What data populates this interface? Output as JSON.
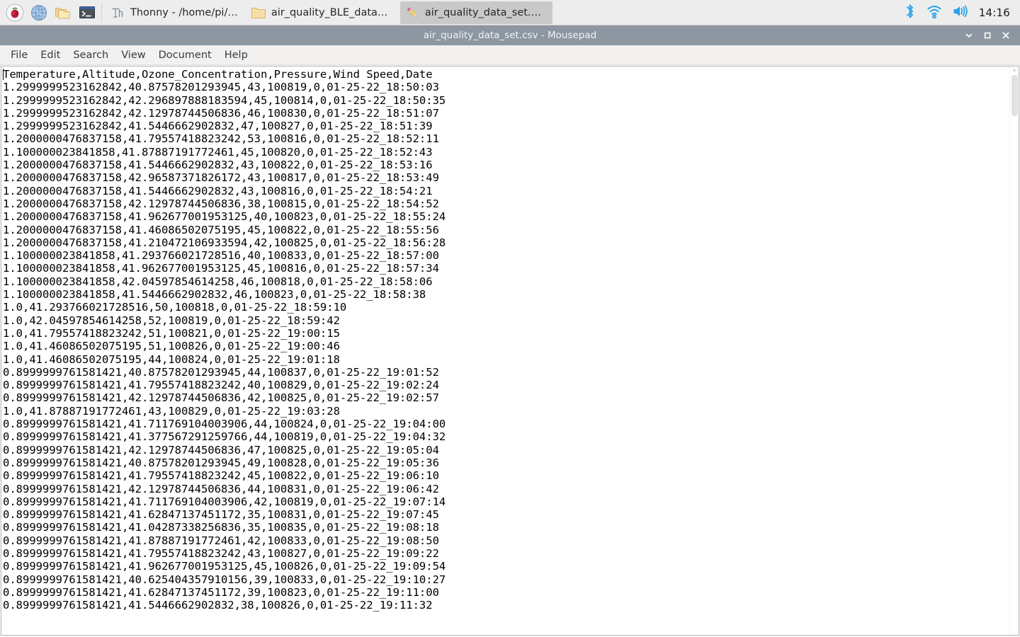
{
  "taskbar": {
    "launchers": [
      {
        "name": "raspberry-pi-menu-icon",
        "label": "Raspberry Pi Menu"
      },
      {
        "name": "web-browser-icon",
        "label": "Web Browser"
      },
      {
        "name": "file-manager-icon",
        "label": "File Manager"
      },
      {
        "name": "terminal-icon",
        "label": "Terminal"
      }
    ],
    "windows": [
      {
        "name": "taskbar-window-thonny",
        "icon": "thonny-icon",
        "label": "Thonny  -  /home/pi/…",
        "active": false
      },
      {
        "name": "taskbar-window-folder",
        "icon": "folder-icon",
        "label": "air_quality_BLE_data_…",
        "active": false
      },
      {
        "name": "taskbar-window-mousepad",
        "icon": "mousepad-pencil-icon",
        "label": "air_quality_data_set.c…",
        "active": true
      }
    ],
    "tray": [
      {
        "name": "bluetooth-icon",
        "label": "Bluetooth"
      },
      {
        "name": "wifi-icon",
        "label": "Wireless Network"
      },
      {
        "name": "volume-icon",
        "label": "Volume"
      }
    ],
    "clock": "14:16",
    "accent_color": "#29a3e8"
  },
  "window": {
    "title": "air_quality_data_set.csv - Mousepad",
    "titlebar_color": "#8c97a1",
    "controls": [
      {
        "name": "minimize-button",
        "glyph": "chevron-down-icon"
      },
      {
        "name": "maximize-button",
        "glyph": "square-icon"
      },
      {
        "name": "close-button",
        "glyph": "close-x-icon"
      }
    ]
  },
  "menubar": {
    "items": [
      {
        "name": "menu-file",
        "label": "File"
      },
      {
        "name": "menu-edit",
        "label": "Edit"
      },
      {
        "name": "menu-search",
        "label": "Search"
      },
      {
        "name": "menu-view",
        "label": "View"
      },
      {
        "name": "menu-document",
        "label": "Document"
      },
      {
        "name": "menu-help",
        "label": "Help"
      }
    ]
  },
  "editor": {
    "header_line": "Temperature,Altitude,Ozone_Concentration,Pressure,Wind Speed,Date",
    "columns": [
      "Temperature",
      "Altitude",
      "Ozone_Concentration",
      "Pressure",
      "Wind Speed",
      "Date"
    ],
    "text": "Temperature,Altitude,Ozone_Concentration,Pressure,Wind Speed,Date\n1.2999999523162842,40.87578201293945,43,100819,0,01-25-22_18:50:03\n1.2999999523162842,42.296897888183594,45,100814,0,01-25-22_18:50:35\n1.2999999523162842,42.12978744506836,46,100830,0,01-25-22_18:51:07\n1.2999999523162842,41.5446662902832,47,100827,0,01-25-22_18:51:39\n1.2000000476837158,41.79557418823242,53,100816,0,01-25-22_18:52:11\n1.100000023841858,41.87887191772461,45,100820,0,01-25-22_18:52:43\n1.2000000476837158,41.5446662902832,43,100822,0,01-25-22_18:53:16\n1.2000000476837158,42.96587371826172,43,100817,0,01-25-22_18:53:49\n1.2000000476837158,41.5446662902832,43,100816,0,01-25-22_18:54:21\n1.2000000476837158,42.12978744506836,38,100815,0,01-25-22_18:54:52\n1.2000000476837158,41.962677001953125,40,100823,0,01-25-22_18:55:24\n1.2000000476837158,41.46086502075195,45,100822,0,01-25-22_18:55:56\n1.2000000476837158,41.210472106933594,42,100825,0,01-25-22_18:56:28\n1.100000023841858,41.293766021728516,40,100833,0,01-25-22_18:57:00\n1.100000023841858,41.962677001953125,45,100816,0,01-25-22_18:57:34\n1.100000023841858,42.04597854614258,46,100818,0,01-25-22_18:58:06\n1.100000023841858,41.5446662902832,46,100823,0,01-25-22_18:58:38\n1.0,41.293766021728516,50,100818,0,01-25-22_18:59:10\n1.0,42.04597854614258,52,100819,0,01-25-22_18:59:42\n1.0,41.79557418823242,51,100821,0,01-25-22_19:00:15\n1.0,41.46086502075195,51,100826,0,01-25-22_19:00:46\n1.0,41.46086502075195,44,100824,0,01-25-22_19:01:18\n0.8999999761581421,40.87578201293945,44,100837,0,01-25-22_19:01:52\n0.8999999761581421,41.79557418823242,40,100829,0,01-25-22_19:02:24\n0.8999999761581421,42.12978744506836,42,100825,0,01-25-22_19:02:57\n1.0,41.87887191772461,43,100829,0,01-25-22_19:03:28\n0.8999999761581421,41.711769104003906,44,100824,0,01-25-22_19:04:00\n0.8999999761581421,41.377567291259766,44,100819,0,01-25-22_19:04:32\n0.8999999761581421,42.12978744506836,47,100825,0,01-25-22_19:05:04\n0.8999999761581421,40.87578201293945,49,100828,0,01-25-22_19:05:36\n0.8999999761581421,41.79557418823242,45,100822,0,01-25-22_19:06:10\n0.8999999761581421,42.12978744506836,44,100831,0,01-25-22_19:06:42\n0.8999999761581421,41.711769104003906,42,100819,0,01-25-22_19:07:14\n0.8999999761581421,41.62847137451172,35,100831,0,01-25-22_19:07:45\n0.8999999761581421,41.04287338256836,35,100835,0,01-25-22_19:08:18\n0.8999999761581421,41.87887191772461,42,100833,0,01-25-22_19:08:50\n0.8999999761581421,41.79557418823242,43,100827,0,01-25-22_19:09:22\n0.8999999761581421,41.962677001953125,45,100826,0,01-25-22_19:09:54\n0.8999999761581421,40.625404357910156,39,100833,0,01-25-22_19:10:27\n0.8999999761581421,41.62847137451172,39,100823,0,01-25-22_19:11:00\n0.8999999761581421,41.5446662902832,38,100826,0,01-25-22_19:11:32"
  }
}
